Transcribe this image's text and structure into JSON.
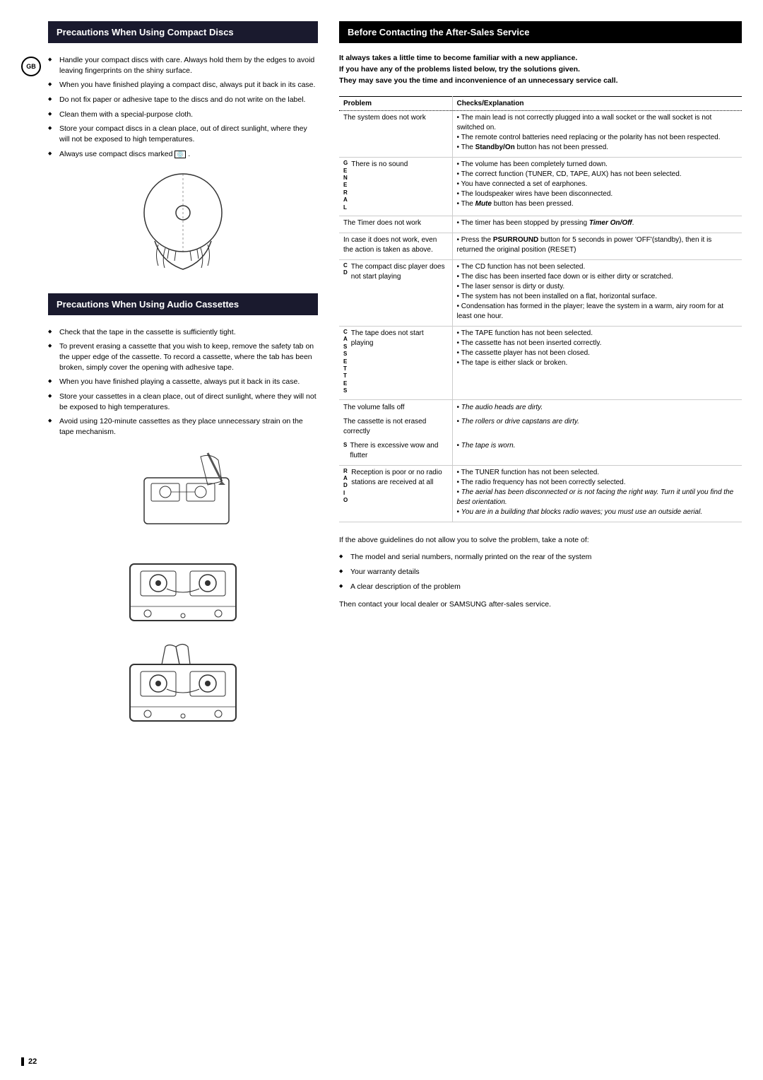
{
  "page": {
    "number": "22",
    "gb_badge": "GB"
  },
  "left": {
    "discs": {
      "header": "Precautions When Using Compact Discs",
      "bullets": [
        "Handle your compact discs with care. Always hold them by the edges to avoid leaving fingerprints on the shiny surface.",
        "When you have finished playing a compact disc, always put it back in its case.",
        "Do not fix paper or adhesive tape to the discs and do not write on the label.",
        "Clean them with a special-purpose cloth.",
        "Store your compact discs in a clean place, out of direct sunlight, where they will not be exposed to high temperatures.",
        "Always use compact discs marked [logo]."
      ]
    },
    "cassettes": {
      "header": "Precautions When Using Audio Cassettes",
      "bullets": [
        "Check that the tape in the cassette is sufficiently tight.",
        "To prevent erasing a cassette that you wish to keep, remove the safety tab on the upper edge of the cassette. To record a cassette, where the tab has been broken, simply cover the opening with adhesive tape.",
        "When you have finished playing a cassette, always put it back in its case.",
        "Store your cassettes in a clean place, out of direct sunlight, where they will not be exposed to high temperatures.",
        "Avoid using 120-minute cassettes as they place unnecessary strain on the tape mechanism."
      ]
    }
  },
  "right": {
    "header": "Before Contacting the After-Sales Service",
    "intro": {
      "line1": "It always takes a little time to become familiar with a new appliance.",
      "line2": "If you have any of the problems listed below, try the solutions given.",
      "line3": "They may save you the time and inconvenience of an unnecessary service call."
    },
    "table": {
      "col1": "Problem",
      "col2": "Checks/Explanation",
      "rows": [
        {
          "group": "",
          "problem": "The system does not work",
          "checks": [
            "The main lead is not correctly plugged into a wall socket or the wall socket is not switched on.",
            "The remote control batteries need replacing or the polarity has not been respected.",
            "The Standby/On button has not been pressed."
          ],
          "checks_bold": [
            3
          ]
        },
        {
          "group": "GENERAL",
          "group_label": "G\nE\nN\nE\nR\nA\nL",
          "problem": "There is no sound",
          "checks": [
            "The volume has been completely turned down.",
            "The correct function (TUNER, CD, TAPE, AUX) has not been selected.",
            "You have connected a set of earphones.",
            "The loudspeaker wires have been disconnected.",
            "The Mute button has been pressed."
          ],
          "checks_bold": [
            5
          ]
        },
        {
          "group": "",
          "problem": "The Timer does not work",
          "checks": [
            "The timer has been stopped by pressing Timer On/Off."
          ],
          "checks_bold_italic": [
            1
          ]
        },
        {
          "group": "",
          "problem": "In case it does not work, even the action is taken as above.",
          "checks": [
            "Press the PSURROUND button for 5 seconds in power 'OFF'(standby), then it is returned the original position (RESET)"
          ],
          "checks_bold": [
            1
          ]
        },
        {
          "group": "CD",
          "group_label": "C\nD",
          "problem": "The compact disc player does not start playing",
          "checks": [
            "The CD function has not been selected.",
            "The disc has been inserted face down or is either dirty or scratched.",
            "The laser sensor is dirty or dusty.",
            "The system has not been installed on a flat, horizontal surface.",
            "Condensation has formed in the player; leave the system in a warm, airy room for at least one hour."
          ]
        },
        {
          "group": "CASSETTE",
          "group_label": "C\nA\nS\nS\nE\nT\nT\nE\nS",
          "problem": "The tape does not start playing",
          "checks": [
            "The TAPE function has not been selected.",
            "The cassette has not been inserted correctly.",
            "The cassette player has not been closed.",
            "The tape is either slack or broken."
          ]
        },
        {
          "group": "",
          "problem": "The volume falls off",
          "checks": [
            "The audio heads are dirty."
          ]
        },
        {
          "group": "",
          "problem": "The cassette is not erased correctly",
          "checks": [
            "The rollers or drive capstans are dirty."
          ]
        },
        {
          "group": "",
          "problem": "There is excessive wow and flutter",
          "checks": [
            "The tape is worn."
          ]
        },
        {
          "group": "RADIO",
          "group_label": "R\nA\nD\nI\nO",
          "problem": "Reception is poor or no radio stations are received at all",
          "checks": [
            "The TUNER function has not been selected.",
            "The radio frequency has not been correctly selected.",
            "The aerial has been disconnected or is not facing the right way. Turn it until you find the best orientation.",
            "You are in a building that blocks radio waves; you must use an outside aerial."
          ]
        }
      ]
    },
    "after_text": {
      "intro": "If the above guidelines do not allow you to solve the problem, take a note of:",
      "bullets": [
        "The model and serial numbers, normally printed on the rear of the system",
        "Your warranty details",
        "A clear description of the problem"
      ],
      "outro": "Then contact your local dealer or SAMSUNG after-sales service."
    }
  }
}
